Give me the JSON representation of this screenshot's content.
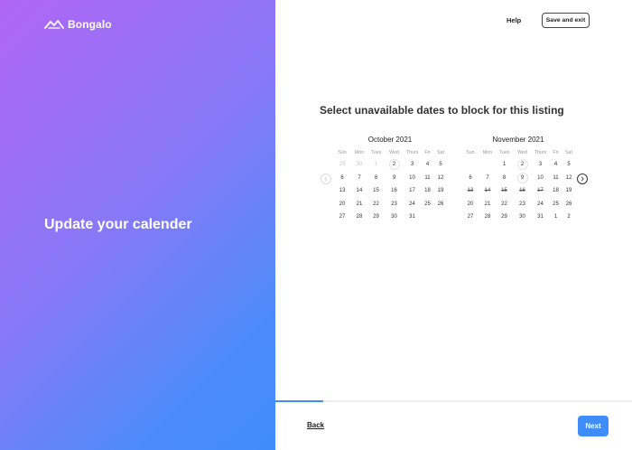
{
  "brand": {
    "name": "Bongalo",
    "accent": "#3f8cfb",
    "gradient_start": "#b066f5",
    "gradient_end": "#3f8cfb"
  },
  "hero": {
    "title": "Update your calender"
  },
  "header": {
    "help_label": "Help",
    "save_exit_label": "Save and exit"
  },
  "main": {
    "question": "Select unavailable dates to block for this listing"
  },
  "calendar": {
    "weekdays": [
      "Sun",
      "Mon",
      "Tues",
      "Wed",
      "Thurs",
      "Fri",
      "Sat"
    ],
    "months": [
      {
        "title": "October 2021",
        "weeks": [
          [
            "29",
            "30",
            "1",
            "2",
            "3",
            "4",
            "5"
          ],
          [
            "6",
            "7",
            "8",
            "9",
            "10",
            "11",
            "12"
          ],
          [
            "13",
            "14",
            "15",
            "16",
            "17",
            "18",
            "19"
          ],
          [
            "20",
            "21",
            "22",
            "23",
            "24",
            "25",
            "26"
          ],
          [
            "27",
            "28",
            "29",
            "30",
            "31",
            "",
            ""
          ]
        ]
      },
      {
        "title": "November 2021",
        "weeks": [
          [
            "",
            "",
            "1",
            "2",
            "3",
            "4",
            "5"
          ],
          [
            "6",
            "7",
            "8",
            "9",
            "10",
            "11",
            "12"
          ],
          [
            "13",
            "14",
            "15",
            "16",
            "17",
            "18",
            "19"
          ],
          [
            "20",
            "21",
            "22",
            "23",
            "24",
            "25",
            "26"
          ],
          [
            "27",
            "28",
            "29",
            "30",
            "31",
            "1",
            "2"
          ]
        ]
      }
    ],
    "prev_icon": "chevron-left-icon",
    "next_icon": "chevron-right-icon"
  },
  "progress": {
    "fraction": 0.135
  },
  "footer": {
    "back_label": "Back",
    "next_label": "Next"
  }
}
